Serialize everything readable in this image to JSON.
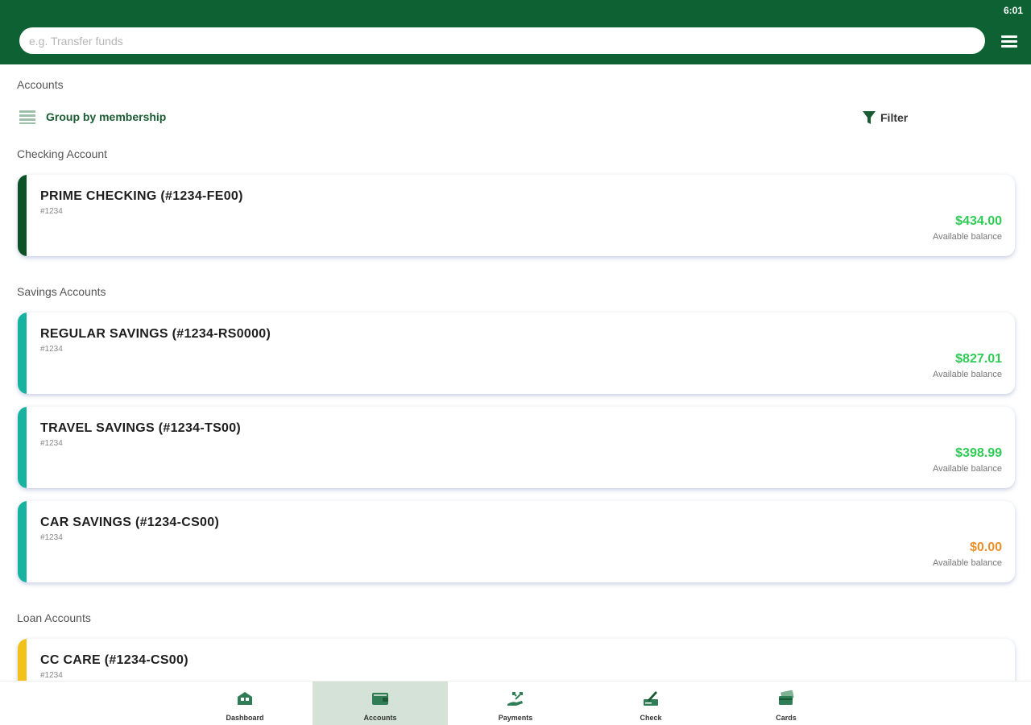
{
  "status_bar": {
    "time": "6:01"
  },
  "search": {
    "placeholder": "e.g. Transfer funds"
  },
  "menu": {
    "icon": "hamburger-menu-icon"
  },
  "page": {
    "title": "Accounts",
    "group_by_label": "Group by membership",
    "filter_label": "Filter"
  },
  "sections": {
    "checking": "Checking Account",
    "savings": "Savings Accounts",
    "loan": "Loan Accounts"
  },
  "accounts": [
    {
      "name": "PRIME CHECKING (#1234-FE00)",
      "number": "#1234",
      "balance": "$434.00",
      "balance_label": "Available balance",
      "accent": "#0d5226",
      "balance_color": "#2ecc55"
    },
    {
      "name": "REGULAR SAVINGS (#1234-RS0000)",
      "number": "#1234",
      "balance": "$827.01",
      "balance_label": "Available balance",
      "accent": "#18b2a0",
      "balance_color": "#2ecc55"
    },
    {
      "name": "TRAVEL SAVINGS (#1234-TS00)",
      "number": "#1234",
      "balance": "$398.99",
      "balance_label": "Available balance",
      "accent": "#18b2a0",
      "balance_color": "#2ecc55"
    },
    {
      "name": "CAR SAVINGS (#1234-CS00)",
      "number": "#1234",
      "balance": "$0.00",
      "balance_label": "Available balance",
      "accent": "#18b2a0",
      "balance_color": "#e8902a"
    },
    {
      "name": "CC CARE (#1234-CS00)",
      "number": "#1234",
      "balance": "",
      "balance_label": "",
      "accent": "#f2c21b",
      "balance_color": "#2ecc55"
    }
  ],
  "nav": [
    {
      "label": "Dashboard",
      "icon": "dashboard-icon",
      "active": false
    },
    {
      "label": "Accounts",
      "icon": "wallet-icon",
      "active": true
    },
    {
      "label": "Payments",
      "icon": "payments-icon",
      "active": false
    },
    {
      "label": "Check",
      "icon": "check-deposit-icon",
      "active": false
    },
    {
      "label": "Cards",
      "icon": "cards-icon",
      "active": false
    }
  ],
  "colors": {
    "brand": "#0d6133",
    "nav_active_bg": "#d4e2d8"
  }
}
